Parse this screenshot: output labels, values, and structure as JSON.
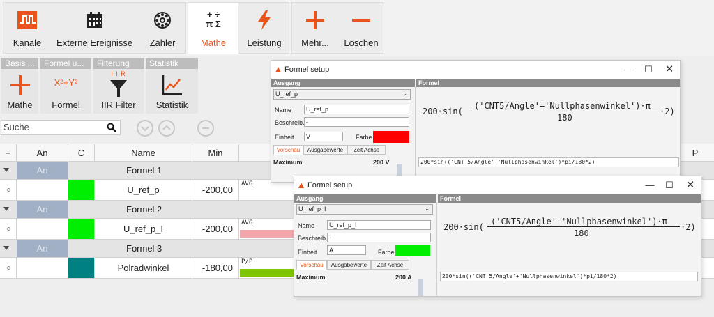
{
  "ribbon": {
    "kanaele": "Kanäle",
    "externe": "Externe Ereignisse",
    "zaehler": "Zähler",
    "mathe": "Mathe",
    "leistung": "Leistung",
    "mehr": "Mehr...",
    "loeschen": "Löschen",
    "math_icon_top": "+ ÷",
    "math_icon_bottom": "π Σ"
  },
  "subtoolbar": {
    "basis_header": "Basis ...",
    "formel_header": "Formel u...",
    "filter_header": "Filterung",
    "statistik_header": "Statistik",
    "mathe_label": "Mathe",
    "formel_label": "Formel",
    "formel_icon": "X²+Y²",
    "iir_icon": "I I R",
    "iir_label": "IIR Filter",
    "statistik_label": "Statistik"
  },
  "search": {
    "placeholder": "Suche"
  },
  "table": {
    "headers": {
      "plus": "+",
      "an": "An",
      "c": "C",
      "name": "Name",
      "min": "Min"
    },
    "groups": [
      {
        "an": "An",
        "name": "Formel 1"
      },
      {
        "an": "An",
        "name": "Formel 2"
      },
      {
        "an": "An",
        "name": "Formel 3"
      }
    ],
    "rows": [
      {
        "name": "U_ref_p",
        "min": "-200,00",
        "tag": "AVG",
        "color": "#00ee00"
      },
      {
        "name": "U_ref_p_I",
        "min": "-200,00",
        "tag": "AVG",
        "color": "#00ee00"
      },
      {
        "name": "Polradwinkel",
        "min": "-180,00",
        "tag": "P/P",
        "color": "#008080"
      }
    ]
  },
  "dialog1": {
    "title": "Formel setup",
    "ausgang": "Ausgang",
    "formel": "Formel",
    "dropdown": "U_ref_p",
    "name_label": "Name",
    "name_value": "U_ref_p",
    "beschreib_label": "Beschreib.",
    "beschreib_value": "-",
    "einheit_label": "Einheit",
    "einheit_value": "V",
    "farbe_label": "Farbe",
    "farbe_color": "#ff0000",
    "tabs": [
      "Vorschau",
      "Ausgabewerte",
      "Zeit Achse"
    ],
    "maximum_label": "Maximum",
    "maximum_value": "200 V",
    "formula_prefix": "200·sin(",
    "formula_numerator": "('CNT5/Angle'+'Nullphasenwinkel')·π",
    "formula_denominator": "180",
    "formula_suffix": "·2)",
    "formula_text": "200*sin(('CNT 5/Angle'+'Nullphasenwinkel')*pi/180*2)"
  },
  "dialog2": {
    "title": "Formel setup",
    "ausgang": "Ausgang",
    "formel": "Formel",
    "dropdown": "U_ref_p_I",
    "name_label": "Name",
    "name_value": "U_ref_p_I",
    "beschreib_label": "Beschreib.",
    "beschreib_value": "-",
    "einheit_label": "Einheit",
    "einheit_value": "A",
    "farbe_label": "Farbe",
    "farbe_color": "#00ee00",
    "tabs": [
      "Vorschau",
      "Ausgabewerte",
      "Zeit Achse"
    ],
    "maximum_label": "Maximum",
    "maximum_value": "200 A",
    "formula_prefix": "200·sin(",
    "formula_numerator": "('CNT5/Angle'+'Nullphasenwinkel')·π",
    "formula_denominator": "180",
    "formula_suffix": "·2)",
    "formula_text": "200*sin(('CNT 5/Angle'+'Nullphasenwinkel')*pi/180*2)"
  },
  "background_header_p": "P",
  "colors": {
    "accent": "#e8541c",
    "header_gray": "#bdbdbd",
    "section_gray": "#8a8a8a",
    "an_blue": "#a2b0c6"
  }
}
